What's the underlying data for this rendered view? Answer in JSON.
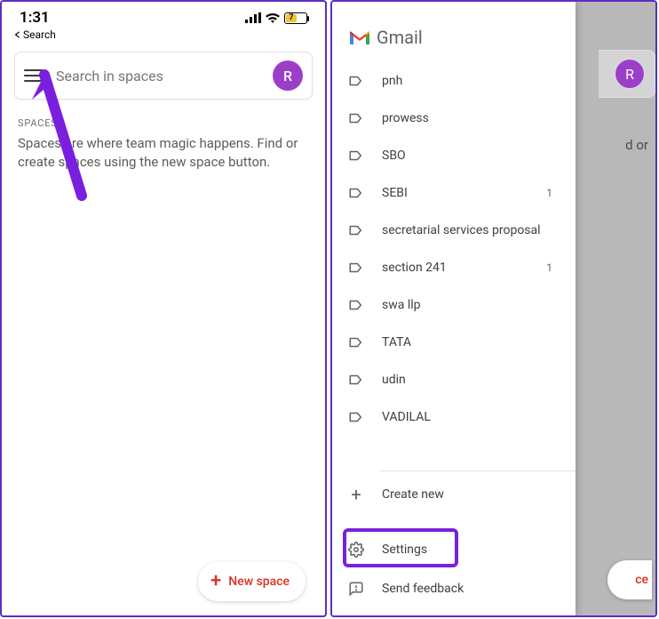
{
  "screen1": {
    "time": "1:31",
    "back_label": "Search",
    "battery_percent": "7",
    "search_placeholder": "Search in spaces",
    "avatar_letter": "R",
    "section_label": "SPACES",
    "description": "Spaces are where team magic happens. Find or create spaces using the new space button.",
    "fab_label": "New space"
  },
  "screen2": {
    "app_name": "Gmail",
    "avatar_letter": "R",
    "dim_text_fragment": "d or",
    "fab_fragment": "ce",
    "labels": [
      {
        "name": "pnh",
        "count": ""
      },
      {
        "name": "prowess",
        "count": ""
      },
      {
        "name": "SBO",
        "count": ""
      },
      {
        "name": "SEBI",
        "count": "1"
      },
      {
        "name": "secretarial services proposal",
        "count": ""
      },
      {
        "name": "section 241",
        "count": "1"
      },
      {
        "name": "swa llp",
        "count": ""
      },
      {
        "name": "TATA",
        "count": ""
      },
      {
        "name": "udin",
        "count": ""
      },
      {
        "name": "VADILAL",
        "count": ""
      }
    ],
    "create_new": "Create new",
    "settings": "Settings",
    "send_feedback": "Send feedback"
  }
}
